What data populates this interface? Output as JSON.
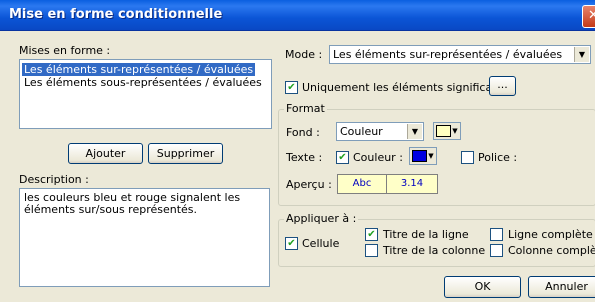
{
  "window": {
    "title": "Mise en forme conditionnelle",
    "close_glyph": "✕"
  },
  "left": {
    "list_label": "Mises en forme :",
    "list_items": [
      {
        "label": "Les éléments sur-représentées / évaluées",
        "selected": true
      },
      {
        "label": "Les éléments sous-représentées / évaluées",
        "selected": false
      }
    ],
    "add_button": "Ajouter",
    "delete_button": "Supprimer",
    "description_label": "Description :",
    "description_text": "les couleurs bleu et rouge signalent les éléments sur/sous représentés."
  },
  "right": {
    "mode_label": "Mode :",
    "mode_value": "Les éléments sur-représentées / évaluées",
    "significant_label": "Uniquement les éléments significatifs",
    "significant_checked": true,
    "ellipsis_button": "...",
    "format": {
      "group_label": "Format",
      "background_label": "Fond :",
      "background_value": "Couleur",
      "background_color": "#ffffc0",
      "text_label": "Texte :",
      "color_checkbox_label": "Couleur :",
      "color_checked": true,
      "text_color": "#0000e0",
      "font_checkbox_label": "Police :",
      "font_checked": false,
      "preview_label": "Aperçu :",
      "preview_text_1": "Abc",
      "preview_text_2": "3.14"
    },
    "apply": {
      "group_label": "Appliquer à :",
      "cell_label": "Cellule",
      "cell_checked": true,
      "row_title_label": "Titre de la ligne",
      "row_title_checked": true,
      "col_title_label": "Titre de la colonne",
      "col_title_checked": false,
      "full_row_label": "Ligne complète",
      "full_row_checked": false,
      "full_col_label": "Colonne complète",
      "full_col_checked": false
    }
  },
  "footer": {
    "ok_button": "OK",
    "cancel_button": "Annuler"
  },
  "icons": {
    "checkmark": "✔",
    "dropdown": "▼"
  }
}
